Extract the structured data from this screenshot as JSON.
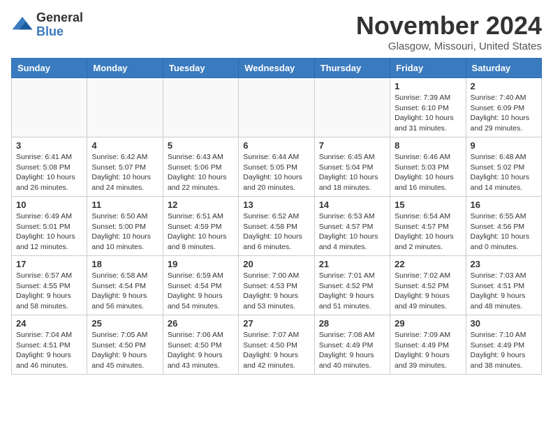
{
  "logo": {
    "general": "General",
    "blue": "Blue"
  },
  "header": {
    "month": "November 2024",
    "location": "Glasgow, Missouri, United States"
  },
  "weekdays": [
    "Sunday",
    "Monday",
    "Tuesday",
    "Wednesday",
    "Thursday",
    "Friday",
    "Saturday"
  ],
  "weeks": [
    [
      {
        "day": "",
        "detail": ""
      },
      {
        "day": "",
        "detail": ""
      },
      {
        "day": "",
        "detail": ""
      },
      {
        "day": "",
        "detail": ""
      },
      {
        "day": "",
        "detail": ""
      },
      {
        "day": "1",
        "detail": "Sunrise: 7:39 AM\nSunset: 6:10 PM\nDaylight: 10 hours\nand 31 minutes."
      },
      {
        "day": "2",
        "detail": "Sunrise: 7:40 AM\nSunset: 6:09 PM\nDaylight: 10 hours\nand 29 minutes."
      }
    ],
    [
      {
        "day": "3",
        "detail": "Sunrise: 6:41 AM\nSunset: 5:08 PM\nDaylight: 10 hours\nand 26 minutes."
      },
      {
        "day": "4",
        "detail": "Sunrise: 6:42 AM\nSunset: 5:07 PM\nDaylight: 10 hours\nand 24 minutes."
      },
      {
        "day": "5",
        "detail": "Sunrise: 6:43 AM\nSunset: 5:06 PM\nDaylight: 10 hours\nand 22 minutes."
      },
      {
        "day": "6",
        "detail": "Sunrise: 6:44 AM\nSunset: 5:05 PM\nDaylight: 10 hours\nand 20 minutes."
      },
      {
        "day": "7",
        "detail": "Sunrise: 6:45 AM\nSunset: 5:04 PM\nDaylight: 10 hours\nand 18 minutes."
      },
      {
        "day": "8",
        "detail": "Sunrise: 6:46 AM\nSunset: 5:03 PM\nDaylight: 10 hours\nand 16 minutes."
      },
      {
        "day": "9",
        "detail": "Sunrise: 6:48 AM\nSunset: 5:02 PM\nDaylight: 10 hours\nand 14 minutes."
      }
    ],
    [
      {
        "day": "10",
        "detail": "Sunrise: 6:49 AM\nSunset: 5:01 PM\nDaylight: 10 hours\nand 12 minutes."
      },
      {
        "day": "11",
        "detail": "Sunrise: 6:50 AM\nSunset: 5:00 PM\nDaylight: 10 hours\nand 10 minutes."
      },
      {
        "day": "12",
        "detail": "Sunrise: 6:51 AM\nSunset: 4:59 PM\nDaylight: 10 hours\nand 8 minutes."
      },
      {
        "day": "13",
        "detail": "Sunrise: 6:52 AM\nSunset: 4:58 PM\nDaylight: 10 hours\nand 6 minutes."
      },
      {
        "day": "14",
        "detail": "Sunrise: 6:53 AM\nSunset: 4:57 PM\nDaylight: 10 hours\nand 4 minutes."
      },
      {
        "day": "15",
        "detail": "Sunrise: 6:54 AM\nSunset: 4:57 PM\nDaylight: 10 hours\nand 2 minutes."
      },
      {
        "day": "16",
        "detail": "Sunrise: 6:55 AM\nSunset: 4:56 PM\nDaylight: 10 hours\nand 0 minutes."
      }
    ],
    [
      {
        "day": "17",
        "detail": "Sunrise: 6:57 AM\nSunset: 4:55 PM\nDaylight: 9 hours\nand 58 minutes."
      },
      {
        "day": "18",
        "detail": "Sunrise: 6:58 AM\nSunset: 4:54 PM\nDaylight: 9 hours\nand 56 minutes."
      },
      {
        "day": "19",
        "detail": "Sunrise: 6:59 AM\nSunset: 4:54 PM\nDaylight: 9 hours\nand 54 minutes."
      },
      {
        "day": "20",
        "detail": "Sunrise: 7:00 AM\nSunset: 4:53 PM\nDaylight: 9 hours\nand 53 minutes."
      },
      {
        "day": "21",
        "detail": "Sunrise: 7:01 AM\nSunset: 4:52 PM\nDaylight: 9 hours\nand 51 minutes."
      },
      {
        "day": "22",
        "detail": "Sunrise: 7:02 AM\nSunset: 4:52 PM\nDaylight: 9 hours\nand 49 minutes."
      },
      {
        "day": "23",
        "detail": "Sunrise: 7:03 AM\nSunset: 4:51 PM\nDaylight: 9 hours\nand 48 minutes."
      }
    ],
    [
      {
        "day": "24",
        "detail": "Sunrise: 7:04 AM\nSunset: 4:51 PM\nDaylight: 9 hours\nand 46 minutes."
      },
      {
        "day": "25",
        "detail": "Sunrise: 7:05 AM\nSunset: 4:50 PM\nDaylight: 9 hours\nand 45 minutes."
      },
      {
        "day": "26",
        "detail": "Sunrise: 7:06 AM\nSunset: 4:50 PM\nDaylight: 9 hours\nand 43 minutes."
      },
      {
        "day": "27",
        "detail": "Sunrise: 7:07 AM\nSunset: 4:50 PM\nDaylight: 9 hours\nand 42 minutes."
      },
      {
        "day": "28",
        "detail": "Sunrise: 7:08 AM\nSunset: 4:49 PM\nDaylight: 9 hours\nand 40 minutes."
      },
      {
        "day": "29",
        "detail": "Sunrise: 7:09 AM\nSunset: 4:49 PM\nDaylight: 9 hours\nand 39 minutes."
      },
      {
        "day": "30",
        "detail": "Sunrise: 7:10 AM\nSunset: 4:49 PM\nDaylight: 9 hours\nand 38 minutes."
      }
    ]
  ]
}
